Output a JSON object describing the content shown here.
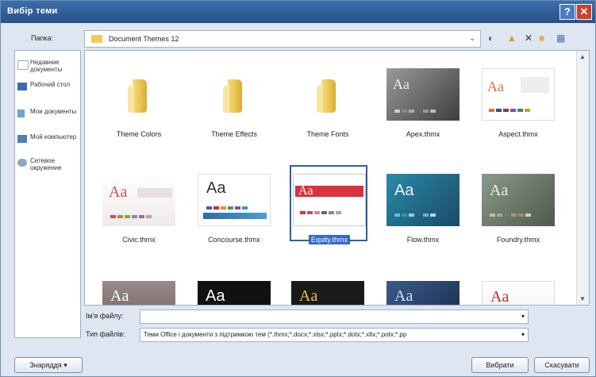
{
  "window": {
    "title": "Вибір теми",
    "help_glyph": "?",
    "close_glyph": "✕"
  },
  "folder_bar": {
    "label": "Папка:",
    "current_folder": "Document Themes 12",
    "dropdown_glyph": "⌄"
  },
  "toolbar_icons": [
    "back-icon",
    "up-folder-icon",
    "delete-icon",
    "new-folder-icon",
    "views-icon"
  ],
  "places": [
    {
      "label": "Недавние документы",
      "icon": "recent-docs-icon"
    },
    {
      "label": "Рабочий стол",
      "icon": "desktop-icon"
    },
    {
      "label": "Мои документы",
      "icon": "my-documents-icon"
    },
    {
      "label": "Мой компьютер",
      "icon": "my-computer-icon"
    },
    {
      "label": "Сетевое окружение",
      "icon": "network-icon"
    }
  ],
  "files": [
    {
      "name": "Theme Colors",
      "kind": "folder"
    },
    {
      "name": "Theme Effects",
      "kind": "folder"
    },
    {
      "name": "Theme Fonts",
      "kind": "folder"
    },
    {
      "name": "Apex.thmx",
      "kind": "theme",
      "thumb_text": "Aa"
    },
    {
      "name": "Aspect.thmx",
      "kind": "theme",
      "thumb_text": "Aa"
    },
    {
      "name": "Civic.thmx",
      "kind": "theme",
      "thumb_text": "Aa"
    },
    {
      "name": "Concourse.thmx",
      "kind": "theme",
      "thumb_text": "Aa"
    },
    {
      "name": "Equity.thmx",
      "kind": "theme",
      "thumb_text": "Aa",
      "selected": true
    },
    {
      "name": "Flow.thmx",
      "kind": "theme",
      "thumb_text": "Aa"
    },
    {
      "name": "Foundry.thmx",
      "kind": "theme",
      "thumb_text": "Aa"
    }
  ],
  "bottom_row_thumb_text": "Aa",
  "filename_field": {
    "label": "Ім'я файлу:",
    "value": ""
  },
  "filetype_field": {
    "label": "Тип файлів:",
    "value": "Теми Office і документи з підтримкою тем (*.thmx;*.docx;*.xlsx;*.pptx;*.dotx;*.xltx;*.potx;*.pp"
  },
  "buttons": {
    "tools": "Знаряддя",
    "open": "Вибрати",
    "cancel": "Скасувати"
  },
  "colors": {
    "titlebar": "#2f5f9c",
    "selection": "#3369c7",
    "close": "#c9432f"
  }
}
